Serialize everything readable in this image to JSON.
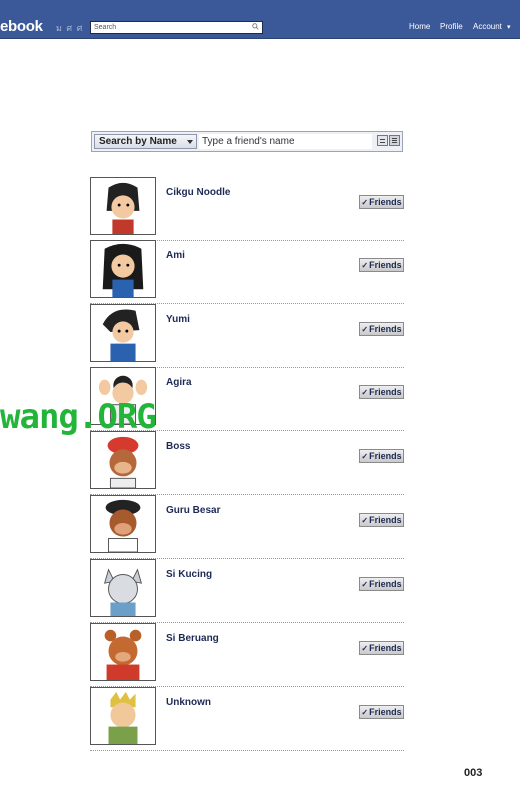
{
  "header": {
    "logo": "ebook",
    "logo_ext": "ม ศ ศ",
    "search_placeholder": "Search",
    "nav": {
      "home": "Home",
      "profile": "Profile",
      "account": "Account",
      "account_arrow": "▾"
    }
  },
  "filter": {
    "mode_label": "Search by Name",
    "input_placeholder": "Type a friend's name"
  },
  "friends": [
    {
      "name": "Cikgu Noodle",
      "button": "Friends"
    },
    {
      "name": "Ami",
      "button": "Friends"
    },
    {
      "name": "Yumi",
      "button": "Friends"
    },
    {
      "name": "Agira",
      "button": "Friends"
    },
    {
      "name": "Boss",
      "button": "Friends"
    },
    {
      "name": "Guru Besar",
      "button": "Friends"
    },
    {
      "name": "Si Kucing",
      "button": "Friends"
    },
    {
      "name": "Si Beruang",
      "button": "Friends"
    },
    {
      "name": "Unknown",
      "button": "Friends"
    }
  ],
  "watermark": "wang.ORG",
  "page_number": "003",
  "colors": {
    "topbar": "#3b5998",
    "name_text": "#1d2a55",
    "watermark": "#22b53a"
  }
}
